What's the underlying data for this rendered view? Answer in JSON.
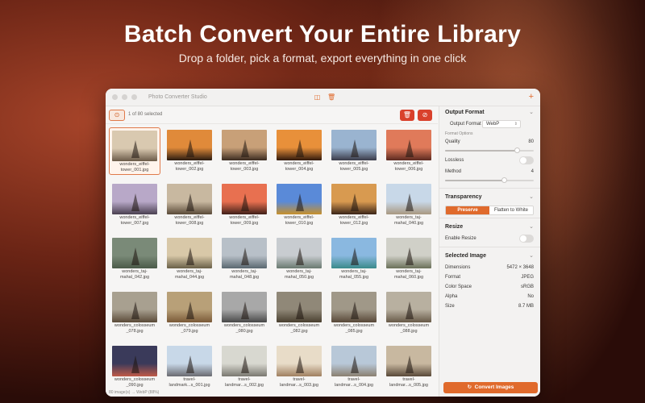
{
  "hero": {
    "title": "Batch Convert Your Entire Library",
    "subtitle": "Drop a folder, pick a format, export everything in one click"
  },
  "window": {
    "title": "Photo Converter Studio",
    "toolbar_icons": [
      "sidebar-icon",
      "trash-icon",
      "plus-icon"
    ]
  },
  "selection": {
    "count_text": "1 of 80 selected"
  },
  "images": [
    {
      "name": "wonders_eiffel-tower_001.jpg",
      "line1": "wonders_eiffel-",
      "line2": "tower_001.jpg",
      "sky": "#d9c9b0",
      "ground": "#6a5a48",
      "selected": true
    },
    {
      "name": "wonders_eiffel-tower_002.jpg",
      "line1": "wonders_eiffel-",
      "line2": "tower_002.jpg",
      "sky": "#e08a3a",
      "ground": "#2a1a10",
      "selected": false
    },
    {
      "name": "wonders_eiffel-tower_003.jpg",
      "line1": "wonders_eiffel-",
      "line2": "tower_003.jpg",
      "sky": "#c8a078",
      "ground": "#3a2a20",
      "selected": false
    },
    {
      "name": "wonders_eiffel-tower_004.jpg",
      "line1": "wonders_eiffel-",
      "line2": "tower_004.jpg",
      "sky": "#e8903a",
      "ground": "#30180c",
      "selected": false
    },
    {
      "name": "wonders_eiffel-tower_005.jpg",
      "line1": "wonders_eiffel-",
      "line2": "tower_005.jpg",
      "sky": "#9ab4d0",
      "ground": "#3a3a48",
      "selected": false
    },
    {
      "name": "wonders_eiffel-tower_006.jpg",
      "line1": "wonders_eiffel-",
      "line2": "tower_006.jpg",
      "sky": "#e07a5a",
      "ground": "#5a2a20",
      "selected": false
    },
    {
      "name": "wonders_eiffel-tower_007.jpg",
      "line1": "wonders_eiffel-",
      "line2": "tower_007.jpg",
      "sky": "#b8a8c8",
      "ground": "#4a4050",
      "selected": false
    },
    {
      "name": "wonders_eiffel-tower_008.jpg",
      "line1": "wonders_eiffel-",
      "line2": "tower_008.jpg",
      "sky": "#c8b8a0",
      "ground": "#5a4a38",
      "selected": false
    },
    {
      "name": "wonders_eiffel-tower_009.jpg",
      "line1": "wonders_eiffel-",
      "line2": "tower_009.jpg",
      "sky": "#e87050",
      "ground": "#402018",
      "selected": false
    },
    {
      "name": "wonders_eiffel-tower_010.jpg",
      "line1": "wonders_eiffel-",
      "line2": "tower_010.jpg",
      "sky": "#5a8ad8",
      "ground": "#c8902a",
      "selected": false
    },
    {
      "name": "wonders_eiffel-tower_012.jpg",
      "line1": "wonders_eiffel-",
      "line2": "tower_012.jpg",
      "sky": "#d89a50",
      "ground": "#3a2418",
      "selected": false
    },
    {
      "name": "wonders_taj-mahal_040.jpg",
      "line1": "wonders_taj-",
      "line2": "mahal_040.jpg",
      "sky": "#c8d8e8",
      "ground": "#a89880",
      "selected": false
    },
    {
      "name": "wonders_taj-mahal_042.jpg",
      "line1": "wonders_taj-",
      "line2": "mahal_042.jpg",
      "sky": "#7a8a78",
      "ground": "#4a5a48",
      "selected": false
    },
    {
      "name": "wonders_taj-mahal_044.jpg",
      "line1": "wonders_taj-",
      "line2": "mahal_044.jpg",
      "sky": "#d8c8a8",
      "ground": "#6a6048",
      "selected": false
    },
    {
      "name": "wonders_taj-mahal_048.jpg",
      "line1": "wonders_taj-",
      "line2": "mahal_048.jpg",
      "sky": "#b8c0c8",
      "ground": "#5a6870",
      "selected": false
    },
    {
      "name": "wonders_taj-mahal_050.jpg",
      "line1": "wonders_taj-",
      "line2": "mahal_050.jpg",
      "sky": "#c8ccd0",
      "ground": "#6a7a70",
      "selected": false
    },
    {
      "name": "wonders_taj-mahal_055.jpg",
      "line1": "wonders_taj-",
      "line2": "mahal_055.jpg",
      "sky": "#8ab8e0",
      "ground": "#3a8a8a",
      "selected": false
    },
    {
      "name": "wonders_taj-mahal_060.jpg",
      "line1": "wonders_taj-",
      "line2": "mahal_060.jpg",
      "sky": "#d0d0c8",
      "ground": "#6a7058",
      "selected": false
    },
    {
      "name": "wonders_colosseum_078.jpg",
      "line1": "wonders_colosseum",
      "line2": "_078.jpg",
      "sky": "#a8a090",
      "ground": "#5a4a38",
      "selected": false
    },
    {
      "name": "wonders_colosseum_079.jpg",
      "line1": "wonders_colosseum",
      "line2": "_079.jpg",
      "sky": "#b8a078",
      "ground": "#7a5a38",
      "selected": false
    },
    {
      "name": "wonders_colosseum_080.jpg",
      "line1": "wonders_colosseum",
      "line2": "_080.jpg",
      "sky": "#a8a8a8",
      "ground": "#484848",
      "selected": false
    },
    {
      "name": "wonders_colosseum_082.jpg",
      "line1": "wonders_colosseum",
      "line2": "_082.jpg",
      "sky": "#908878",
      "ground": "#4a4030",
      "selected": false
    },
    {
      "name": "wonders_colosseum_085.jpg",
      "line1": "wonders_colosseum",
      "line2": "_085.jpg",
      "sky": "#a09888",
      "ground": "#584838",
      "selected": false
    },
    {
      "name": "wonders_colosseum_088.jpg",
      "line1": "wonders_colosseum",
      "line2": "_088.jpg",
      "sky": "#b8b0a0",
      "ground": "#685a48",
      "selected": false
    },
    {
      "name": "wonders_colosseum_090.jpg",
      "line1": "wonders_colosseum",
      "line2": "_090.jpg",
      "sky": "#3a3a5a",
      "ground": "#c05a48",
      "selected": false
    },
    {
      "name": "travel-landmark...s_001.jpg",
      "line1": "travel-",
      "line2": "landmark...s_001.jpg",
      "sky": "#c8d8e8",
      "ground": "#6a6a70",
      "selected": false
    },
    {
      "name": "travel-landmar...s_002.jpg",
      "line1": "travel-",
      "line2": "landmar...s_002.jpg",
      "sky": "#d8d8d0",
      "ground": "#7a7870",
      "selected": false
    },
    {
      "name": "travel-landmar...s_003.jpg",
      "line1": "travel-",
      "line2": "landmar...s_003.jpg",
      "sky": "#e8dcc8",
      "ground": "#a08060",
      "selected": false
    },
    {
      "name": "travel-landmar...s_004.jpg",
      "line1": "travel-",
      "line2": "landmar...s_004.jpg",
      "sky": "#b8c8d8",
      "ground": "#8a8070",
      "selected": false
    },
    {
      "name": "travel-landmar...s_005.jpg",
      "line1": "travel-",
      "line2": "landmar...s_005.jpg",
      "sky": "#c8b8a0",
      "ground": "#584838",
      "selected": false
    }
  ],
  "status": "80 image(s) → WebP (88%)",
  "settings": {
    "output_format": {
      "section": "Output Format",
      "label": "Output Format",
      "value": "WebP"
    },
    "format_options_label": "Format Options",
    "quality": {
      "label": "Quality",
      "value": "80",
      "level": 0.8
    },
    "lossless": {
      "label": "Lossless",
      "on": false
    },
    "method": {
      "label": "Method",
      "value": "4",
      "level": 0.66
    },
    "transparency": {
      "section": "Transparency",
      "options": [
        "Preserve",
        "Flatten to White"
      ],
      "selected": "Preserve"
    },
    "resize": {
      "section": "Resize",
      "enable_label": "Enable Resize",
      "on": false
    },
    "selected_image": {
      "section": "Selected Image",
      "rows": [
        {
          "label": "Dimensions",
          "value": "5472 × 3648"
        },
        {
          "label": "Format",
          "value": "JPEG"
        },
        {
          "label": "Color Space",
          "value": "sRGB"
        },
        {
          "label": "Alpha",
          "value": "No"
        },
        {
          "label": "Size",
          "value": "8.7 MB"
        }
      ]
    },
    "convert_label": "Convert Images"
  },
  "colors": {
    "accent": "#e06a2c",
    "danger": "#d9412c"
  }
}
